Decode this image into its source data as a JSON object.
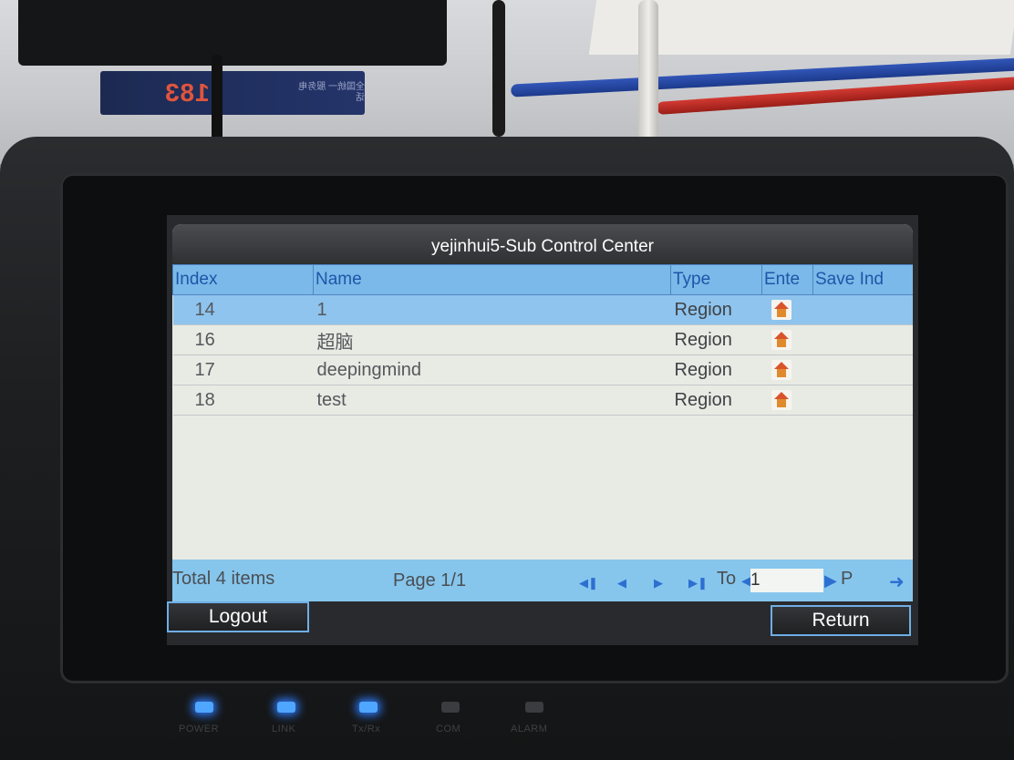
{
  "screen": {
    "title": "yejinhui5-Sub Control Center",
    "columns": {
      "index": "Index",
      "name": "Name",
      "type": "Type",
      "enter": "Ente",
      "save_index": "Save Ind"
    },
    "rows": [
      {
        "index": "14",
        "name": "1",
        "type": "Region",
        "icon": "home-icon",
        "selected": true
      },
      {
        "index": "16",
        "name": "超脑",
        "type": "Region",
        "icon": "home-icon",
        "selected": false
      },
      {
        "index": "17",
        "name": "deepingmind",
        "type": "Region",
        "icon": "home-icon",
        "selected": false
      },
      {
        "index": "18",
        "name": "test",
        "type": "Region",
        "icon": "home-icon",
        "selected": false
      }
    ],
    "status": {
      "total": "Total 4 items",
      "page": "Page 1/1",
      "to_label": "To",
      "page_input": "1",
      "page_suffix": "P"
    },
    "buttons": {
      "logout": "Logout",
      "return": "Return"
    },
    "nav_icons": [
      "first-page-icon",
      "prev-page-icon",
      "next-page-icon",
      "last-page-icon",
      "go-arrow-icon"
    ]
  },
  "device": {
    "leds": [
      {
        "label": "POWER",
        "on": true
      },
      {
        "label": "LINK",
        "on": true
      },
      {
        "label": "Tx/Rx",
        "on": true
      },
      {
        "label": "COM",
        "on": false
      },
      {
        "label": "ALARM",
        "on": false
      }
    ]
  },
  "environment": {
    "card_number": "183",
    "card_text": "全国统一 服务电话"
  },
  "colors": {
    "header_blue": "#7ab9e9",
    "selected_row": "#8ec4ee",
    "status_bar": "#86c6ed",
    "led_blue": "#4fa6ff",
    "title_bar": "#3a3c40"
  }
}
